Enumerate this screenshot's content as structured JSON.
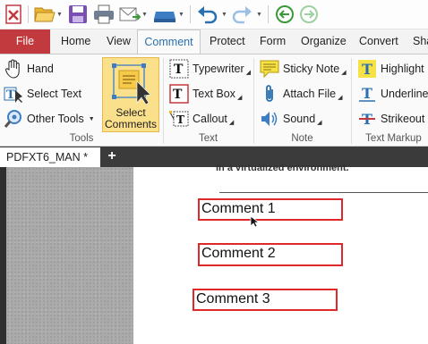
{
  "ribbon_tabs": {
    "file": "File",
    "home": "Home",
    "view": "View",
    "comment": "Comment",
    "protect": "Protect",
    "form": "Form",
    "organize": "Organize",
    "convert": "Convert",
    "share": "Sha"
  },
  "tools_group": {
    "hand": "Hand",
    "select_text": "Select Text",
    "other_tools": "Other Tools",
    "select_comments_line1": "Select",
    "select_comments_line2": "Comments",
    "label": "Tools"
  },
  "text_group": {
    "typewriter": "Typewriter",
    "text_box": "Text Box",
    "callout": "Callout",
    "label": "Text"
  },
  "note_group": {
    "sticky_note": "Sticky Note",
    "attach_file": "Attach File",
    "sound": "Sound",
    "label": "Note"
  },
  "markup_group": {
    "highlight": "Highlight",
    "underline": "Underline",
    "strikeout": "Strikeout",
    "label": "Text Markup"
  },
  "document": {
    "tab_name": "PDFXT6_MAN *",
    "top_text": "in a virtualized environment.",
    "comments": [
      "Comment 1",
      "Comment 2",
      "Comment 3"
    ]
  },
  "colors": {
    "file_tab": "#c23a3e",
    "active_tab_text": "#2a6fb0",
    "selected_button": "#fbe08c",
    "comment_border": "#e02828"
  }
}
